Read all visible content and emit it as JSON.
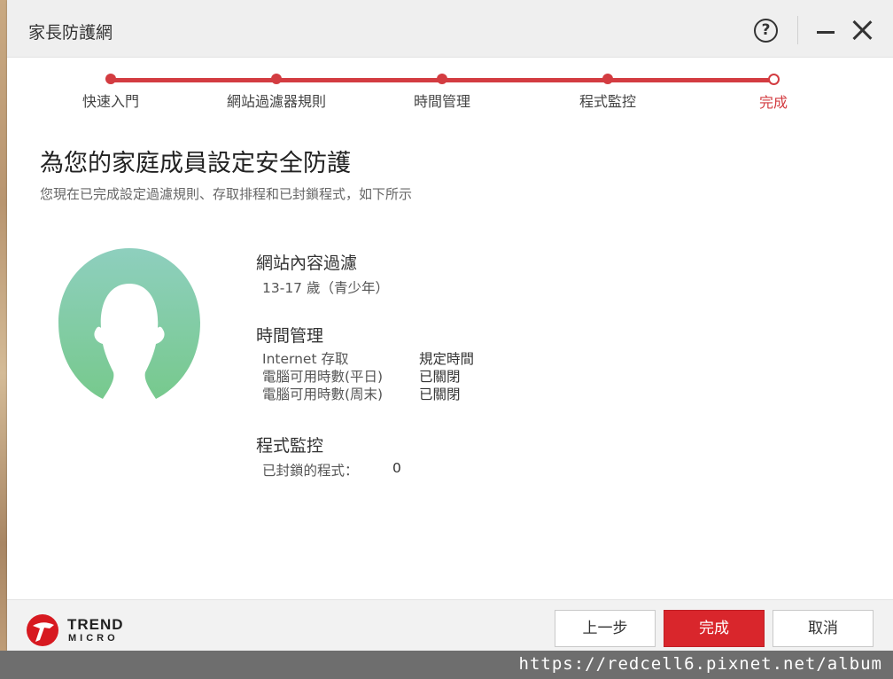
{
  "window": {
    "title": "家長防護網"
  },
  "titlebar": {
    "help_icon": "question-circle-icon",
    "help_glyph": "?",
    "minimize_icon": "minimize-icon",
    "close_icon": "close-icon"
  },
  "steps": [
    {
      "label": "快速入門",
      "state": "done"
    },
    {
      "label": "網站過濾器規則",
      "state": "done"
    },
    {
      "label": "時間管理",
      "state": "done"
    },
    {
      "label": "程式監控",
      "state": "done"
    },
    {
      "label": "完成",
      "state": "current"
    }
  ],
  "main": {
    "heading": "為您的家庭成員設定安全防護",
    "subheading": "您現在已完成設定過濾規則、存取排程和已封鎖程式，如下所示"
  },
  "summary": {
    "web_filter": {
      "title": "網站內容過濾",
      "value": "13-17 歲（青少年）"
    },
    "time_management": {
      "title": "時間管理",
      "rows": [
        {
          "label": "Internet 存取",
          "value": "規定時間"
        },
        {
          "label": "電腦可用時數(平日)",
          "value": "已關閉"
        },
        {
          "label": "電腦可用時數(周末)",
          "value": "已關閉"
        }
      ]
    },
    "program_control": {
      "title": "程式監控",
      "blocked_label": "已封鎖的程式：",
      "blocked_count": "0"
    }
  },
  "footer": {
    "logo_text_top": "TREND",
    "logo_text_bottom": "MICRO",
    "back_label": "上一步",
    "finish_label": "完成",
    "cancel_label": "取消"
  },
  "watermark": "https://redcell6.pixnet.net/album",
  "colors": {
    "accent": "#d33c41",
    "avatar_top": "#8ecfbe",
    "avatar_bottom": "#77c98d"
  }
}
